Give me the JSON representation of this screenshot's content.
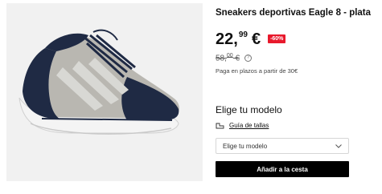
{
  "product": {
    "title": "Sneakers deportivas Eagle 8 - plata",
    "price_integer": "22,",
    "price_decimals": "99",
    "currency": "€",
    "discount_badge": "-60%",
    "old_price_integer": "58,",
    "old_price_decimals": "00",
    "old_price_currency": "€",
    "info_icon_glyph": "?",
    "installments_text": "Paga en plazos a partir de 30€"
  },
  "model": {
    "heading": "Elige tu modelo",
    "size_guide_label": "Guía de tallas",
    "select_value": "Elige tu modelo"
  },
  "actions": {
    "add_to_cart_label": "Añadir a la cesta"
  },
  "colors": {
    "accent_badge": "#e8192c",
    "button_bg": "#000000",
    "shoe_navy": "#1f2a44",
    "shoe_grey": "#b9b7b1"
  }
}
